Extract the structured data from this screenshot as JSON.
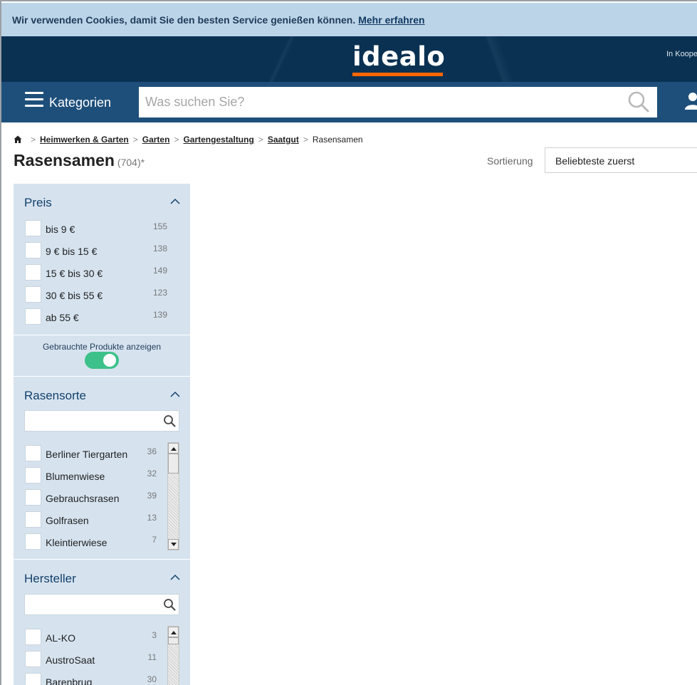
{
  "cookie": {
    "text": "Wir verwenden Cookies, damit Sie den besten Service genießen können.",
    "link": "Mehr erfahren"
  },
  "header": {
    "logo": "idealo",
    "coop_text": "In Koope"
  },
  "nav": {
    "categories_label": "Kategorien",
    "search_placeholder": "Was suchen Sie?"
  },
  "breadcrumb": {
    "items": [
      "Heimwerken & Garten",
      "Garten",
      "Gartengestaltung",
      "Saatgut"
    ],
    "current": "Rasensamen"
  },
  "page": {
    "title": "Rasensamen",
    "count": "(704)*",
    "sort_label": "Sortierung",
    "sort_value": "Beliebteste zuerst"
  },
  "filters": {
    "price": {
      "title": "Preis",
      "options": [
        {
          "label": "bis 9 €",
          "count": "155"
        },
        {
          "label": "9 € bis 15 €",
          "count": "138"
        },
        {
          "label": "15 € bis 30 €",
          "count": "149"
        },
        {
          "label": "30 € bis 55 €",
          "count": "123"
        },
        {
          "label": "ab 55 €",
          "count": "139"
        }
      ]
    },
    "used": {
      "label": "Gebrauchte Produkte anzeigen",
      "enabled": true
    },
    "grass_type": {
      "title": "Rasensorte",
      "options": [
        {
          "label": "Berliner Tiergarten",
          "count": "36"
        },
        {
          "label": "Blumenwiese",
          "count": "32"
        },
        {
          "label": "Gebrauchsrasen",
          "count": "39"
        },
        {
          "label": "Golfrasen",
          "count": "13"
        },
        {
          "label": "Kleintierwiese",
          "count": "7"
        }
      ]
    },
    "manufacturer": {
      "title": "Hersteller",
      "options": [
        {
          "label": "AL-KO",
          "count": "3"
        },
        {
          "label": "AustroSaat",
          "count": "11"
        },
        {
          "label": "Barenbrug",
          "count": "30"
        }
      ]
    }
  },
  "colors": {
    "header_bg": "#0a3152",
    "nav_bg": "#1e4f7a",
    "accent": "#ff6600",
    "toggle_on": "#3cc18a",
    "filter_bg": "#d6e3ef"
  }
}
